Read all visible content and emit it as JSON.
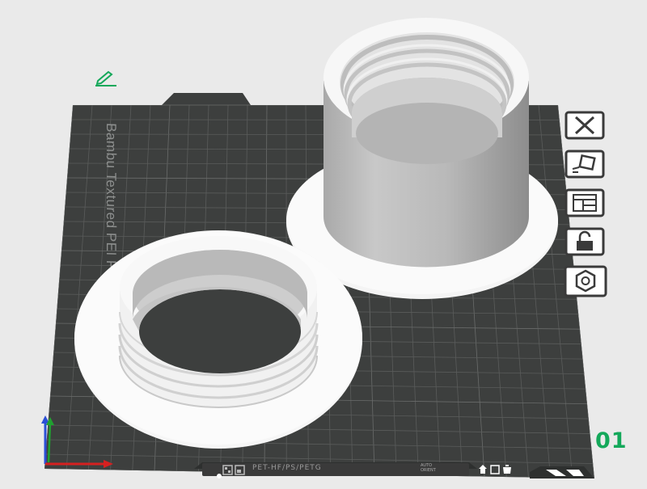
{
  "plate": {
    "name": "Bambu Textured PEI Plate",
    "number": "01"
  },
  "bottom_bar": {
    "filament": "PET-HF/PS/PETG",
    "mode_lines": [
      "AUTO",
      "ORIENT"
    ]
  },
  "toolbar": {
    "items": [
      {
        "name": "remove-plate-button",
        "icon": "close-icon"
      },
      {
        "name": "auto-orient-button",
        "icon": "auto-orient-icon"
      },
      {
        "name": "arrange-button",
        "icon": "arrange-icon"
      },
      {
        "name": "lock-plate-button",
        "icon": "unlock-icon"
      },
      {
        "name": "plate-settings-button",
        "icon": "hex-nut-icon"
      }
    ]
  },
  "colors": {
    "plate": "#3d3f3e",
    "grid": "#5b5d5c",
    "object": "#f2f2f2",
    "accent": "#14a85a"
  }
}
